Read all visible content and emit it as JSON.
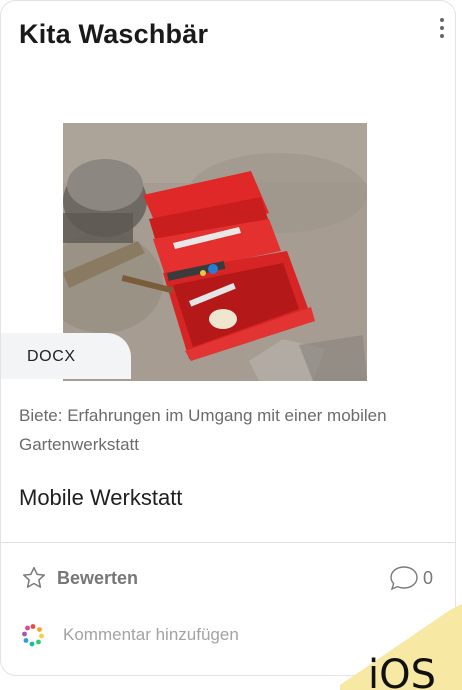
{
  "card": {
    "title": "Kita Waschbär",
    "format_badge": "DOCX",
    "description": "Biete: Erfahrungen im Umgang mit einer mobilen Gartenwerkstatt",
    "subtitle": "Mobile Werkstatt"
  },
  "actions": {
    "rate_label": "Bewerten",
    "comment_count": "0",
    "add_comment_placeholder": "Kommentar hinzufügen"
  },
  "overlay": {
    "text": "iOS"
  },
  "icons": {
    "menu": "more-vertical-icon",
    "rate": "star-outline-icon",
    "comments": "speech-bubble-icon",
    "user": "colorful-dots-avatar-icon"
  },
  "colors": {
    "sticker": "#f7e8a4",
    "toolbox_red": "#d42222"
  }
}
